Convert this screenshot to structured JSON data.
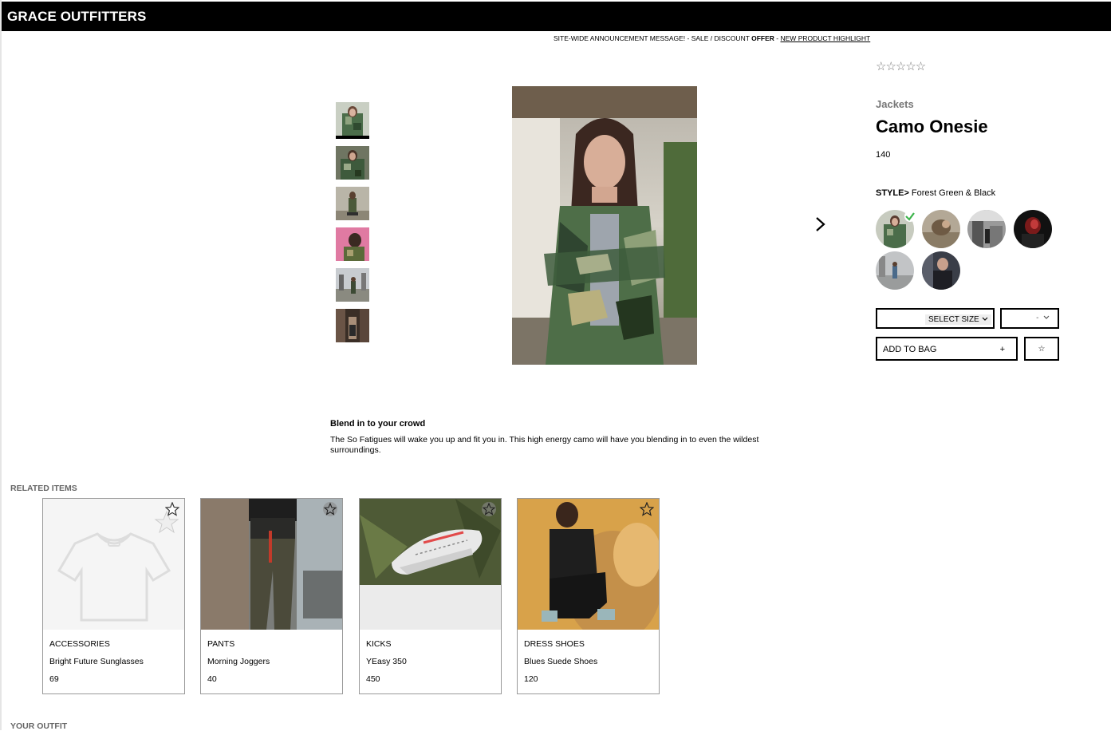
{
  "header": {
    "brand": "GRACE OUTFITTERS"
  },
  "announcement": {
    "prefix": "SITE-WIDE ANNOUNCEMENT MESSAGE! - SALE / DISCOUNT ",
    "offer": "OFFER",
    "separator": " - ",
    "link": "NEW PRODUCT HIGHLIGHT"
  },
  "product": {
    "rating_stars": "☆☆☆☆☆",
    "category": "Jackets",
    "name": "Camo Onesie",
    "price": "140",
    "style_label": "STYLE>",
    "style_value": " Forest Green & Black",
    "select_size": "SELECT SIZE",
    "quantity": "-",
    "add_to_bag": "ADD TO BAG",
    "add_plus": "+",
    "favorite": "☆",
    "description_title": "Blend in to your crowd",
    "description": "The So Fatigues will wake you up and fit you in. This high energy camo will have you blending in to even the wildest surroundings."
  },
  "related": {
    "label": "RELATED ITEMS",
    "items": [
      {
        "category": "ACCESSORIES",
        "name": "Bright Future Sunglasses",
        "price": "69"
      },
      {
        "category": "PANTS",
        "name": "Morning Joggers",
        "price": "40"
      },
      {
        "category": "KICKS",
        "name": "YEasy 350",
        "price": "450"
      },
      {
        "category": "DRESS SHOES",
        "name": "Blues Suede Shoes",
        "price": "120"
      }
    ]
  },
  "outfit": {
    "label": "YOUR OUTFIT"
  },
  "icons": {
    "next": "chevron-right-icon",
    "rating": "star-outline-icon",
    "selected_style": "check-circle-icon",
    "favorite": "star-outline-icon",
    "placeholder": "t-shirt-icon"
  }
}
